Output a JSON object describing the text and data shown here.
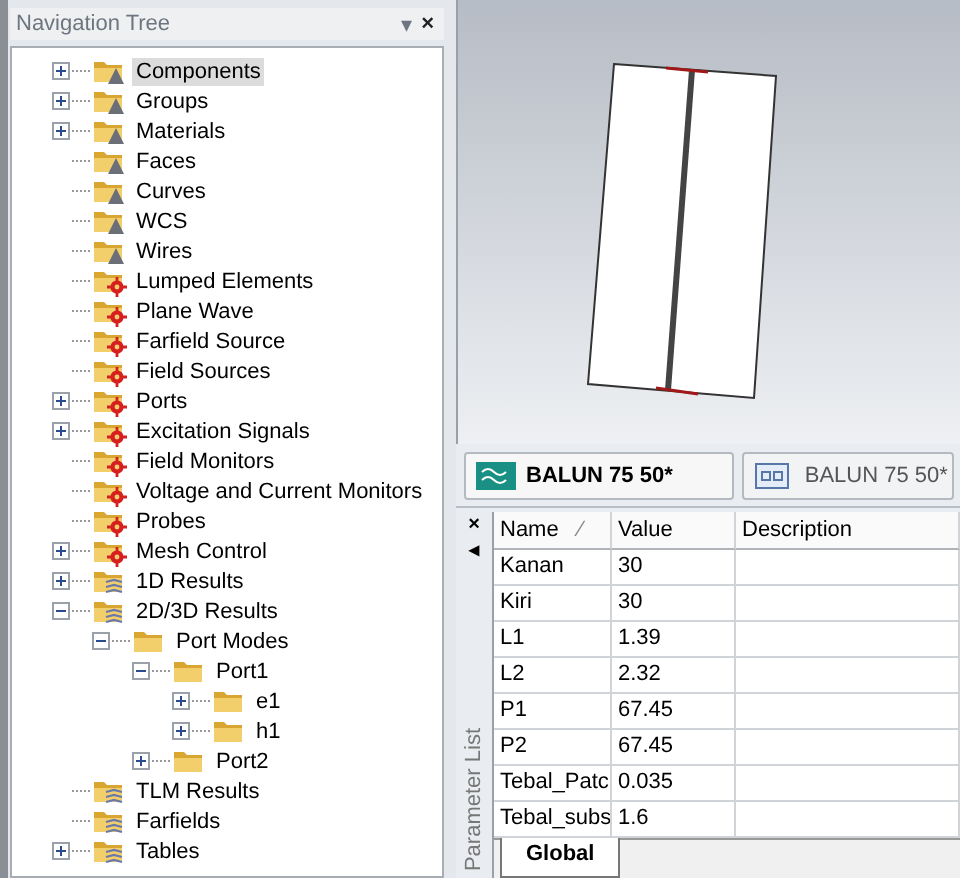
{
  "navigation_tree": {
    "title": "Navigation Tree",
    "menu_glyph": "▾",
    "close_glyph": "×",
    "items": [
      {
        "label": "Components",
        "kind": "structure",
        "expanded": false,
        "selected": true
      },
      {
        "label": "Groups",
        "kind": "structure",
        "expanded": false,
        "selected": false
      },
      {
        "label": "Materials",
        "kind": "structure",
        "expanded": false,
        "selected": false
      },
      {
        "label": "Faces",
        "kind": "structure",
        "selected": false
      },
      {
        "label": "Curves",
        "kind": "structure",
        "selected": false
      },
      {
        "label": "WCS",
        "kind": "structure",
        "selected": false
      },
      {
        "label": "Wires",
        "kind": "structure",
        "selected": false
      },
      {
        "label": "Lumped Elements",
        "kind": "source",
        "selected": false
      },
      {
        "label": "Plane Wave",
        "kind": "source",
        "selected": false
      },
      {
        "label": "Farfield Source",
        "kind": "source",
        "selected": false
      },
      {
        "label": "Field Sources",
        "kind": "source",
        "selected": false
      },
      {
        "label": "Ports",
        "kind": "source",
        "expanded": false,
        "selected": false
      },
      {
        "label": "Excitation Signals",
        "kind": "source",
        "expanded": false,
        "selected": false
      },
      {
        "label": "Field Monitors",
        "kind": "source",
        "selected": false
      },
      {
        "label": "Voltage and Current Monitors",
        "kind": "source",
        "selected": false
      },
      {
        "label": "Probes",
        "kind": "source",
        "selected": false
      },
      {
        "label": "Mesh Control",
        "kind": "source",
        "expanded": false,
        "selected": false
      },
      {
        "label": "1D Results",
        "kind": "result",
        "expanded": false,
        "selected": false
      },
      {
        "label": "2D/3D Results",
        "kind": "result",
        "expanded": true,
        "selected": false,
        "children": [
          {
            "label": "Port Modes",
            "kind": "folder",
            "expanded": true,
            "selected": false,
            "children": [
              {
                "label": "Port1",
                "kind": "folder",
                "expanded": true,
                "selected": false,
                "children": [
                  {
                    "label": "e1",
                    "kind": "folder",
                    "expanded": false,
                    "selected": false
                  },
                  {
                    "label": "h1",
                    "kind": "folder",
                    "expanded": false,
                    "selected": false
                  }
                ]
              },
              {
                "label": "Port2",
                "kind": "folder",
                "expanded": false,
                "selected": false
              }
            ]
          }
        ]
      },
      {
        "label": "TLM Results",
        "kind": "result",
        "selected": false
      },
      {
        "label": "Farfields",
        "kind": "result",
        "selected": false
      },
      {
        "label": "Tables",
        "kind": "result",
        "expanded": false,
        "selected": false
      }
    ]
  },
  "document_tabs": [
    {
      "label": "BALUN 75 50*",
      "kind": "model",
      "selected": true
    },
    {
      "label": "BALUN 75 50*",
      "kind": "schematic",
      "selected": false
    }
  ],
  "parameter_list": {
    "title": "Parameter List",
    "close_glyph": "×",
    "pin_glyph": "◂",
    "columns": [
      {
        "label": "Name",
        "sort_glyph": "⁄"
      },
      {
        "label": "Value"
      },
      {
        "label": "Description"
      }
    ],
    "rows": [
      {
        "name": "Kanan",
        "value": "30"
      },
      {
        "name": "Kiri",
        "value": "30"
      },
      {
        "name": "L1",
        "value": "1.39"
      },
      {
        "name": "L2",
        "value": "2.32"
      },
      {
        "name": "P1",
        "value": "67.45"
      },
      {
        "name": "P2",
        "value": "67.45"
      },
      {
        "name": "Tebal_Patc",
        "value": "0.035"
      },
      {
        "name": "Tebal_subs",
        "value": "1.6"
      }
    ],
    "sheet_tabs": [
      {
        "label": "Global",
        "selected": true
      }
    ]
  }
}
